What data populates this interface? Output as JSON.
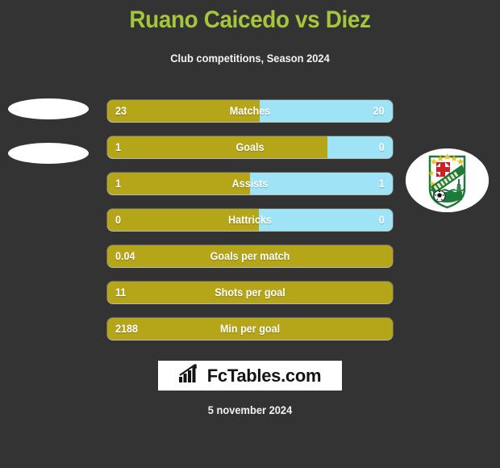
{
  "header": {
    "title": "Ruano Caicedo vs Diez",
    "subtitle": "Club competitions, Season 2024",
    "title_color": "#a4c63a",
    "subtitle_color": "#f2f2f2"
  },
  "colors": {
    "background": "#333333",
    "home_bar": "#b4a519",
    "away_bar": "#9fe3f6",
    "text": "#ffffff"
  },
  "media": {
    "player_left_placeholder": "player-photo-placeholder",
    "player_right_placeholder": "player-photo-placeholder",
    "club_badge": "club-badge-icon"
  },
  "footer": {
    "brand": "FcTables.com",
    "brand_icon": "bar-chart-growth-icon",
    "date": "5 november 2024"
  },
  "chart_data": {
    "type": "bar",
    "title": "Ruano Caicedo vs Diez",
    "subtitle": "Club competitions, Season 2024",
    "orientation": "horizontal-diverging",
    "series": [
      {
        "name": "Ruano Caicedo",
        "color": "#b4a519",
        "side": "left"
      },
      {
        "name": "Diez",
        "color": "#9fe3f6",
        "side": "right"
      }
    ],
    "categories": [
      "Matches",
      "Goals",
      "Assists",
      "Hattricks",
      "Goals per match",
      "Shots per goal",
      "Min per goal"
    ],
    "rows": [
      {
        "label": "Matches",
        "left_value": "23",
        "right_value": "20",
        "left_pct": 53.5,
        "two_sided": true
      },
      {
        "label": "Goals",
        "left_value": "1",
        "right_value": "0",
        "left_pct": 77,
        "two_sided": true
      },
      {
        "label": "Assists",
        "left_value": "1",
        "right_value": "1",
        "left_pct": 50,
        "two_sided": true
      },
      {
        "label": "Hattricks",
        "left_value": "0",
        "right_value": "0",
        "left_pct": 53,
        "two_sided": true
      },
      {
        "label": "Goals per match",
        "left_value": "0.04",
        "right_value": "",
        "left_pct": 100,
        "two_sided": false
      },
      {
        "label": "Shots per goal",
        "left_value": "11",
        "right_value": "",
        "left_pct": 100,
        "two_sided": false
      },
      {
        "label": "Min per goal",
        "left_value": "2188",
        "right_value": "",
        "left_pct": 100,
        "two_sided": false
      }
    ],
    "grid": false,
    "legend": "none"
  }
}
